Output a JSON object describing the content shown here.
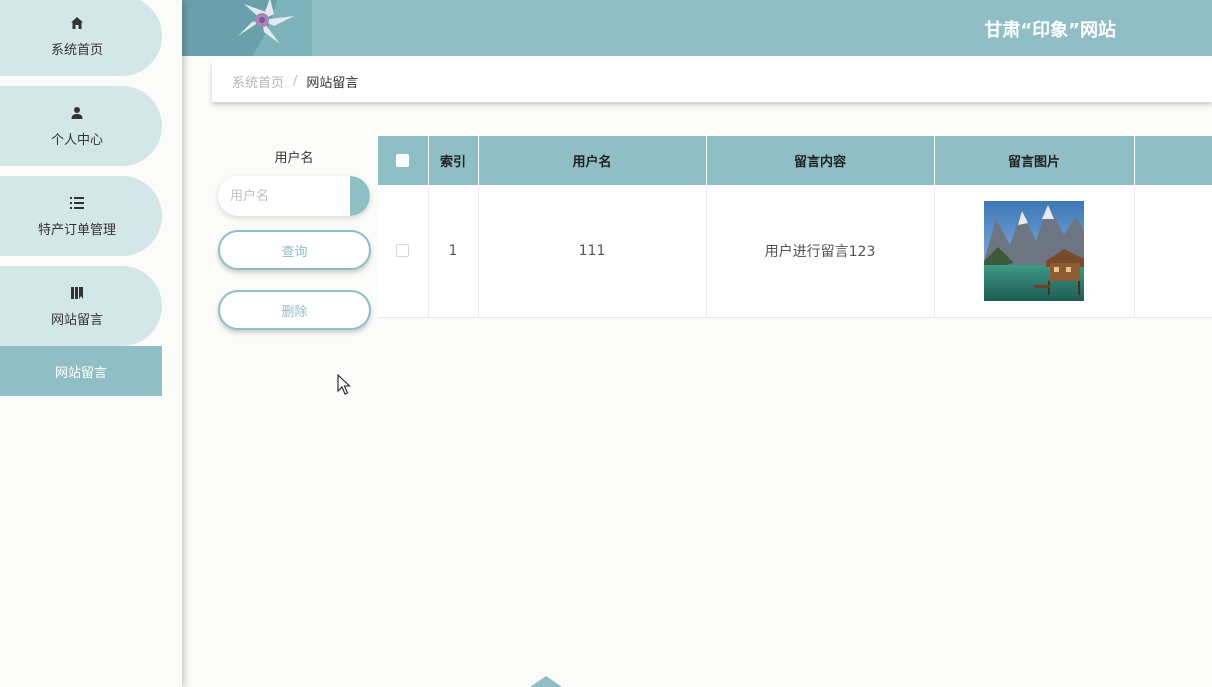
{
  "header": {
    "site_title": "甘肃“印象”网站"
  },
  "sidebar": {
    "items": [
      {
        "label": "系统首页",
        "icon": "home-icon"
      },
      {
        "label": "个人中心",
        "icon": "user-icon"
      },
      {
        "label": "特产订单管理",
        "icon": "list-icon"
      },
      {
        "label": "网站留言",
        "icon": "book-icon"
      }
    ],
    "active_sub": "网站留言"
  },
  "breadcrumb": {
    "home": "系统首页",
    "separator": "/",
    "current": "网站留言"
  },
  "search": {
    "label": "用户名",
    "placeholder": "用户名",
    "query_button": "查询",
    "delete_button": "删除"
  },
  "table": {
    "columns": [
      "索引",
      "用户名",
      "留言内容",
      "留言图片"
    ],
    "rows": [
      {
        "index": "1",
        "username": "111",
        "content": "用户进行留言123",
        "image": "lake-boathouse-photo"
      }
    ]
  },
  "colors": {
    "accent": "#8fbec5",
    "menu_bg": "#d3e6e8",
    "page_bg": "#fbfbf9"
  }
}
